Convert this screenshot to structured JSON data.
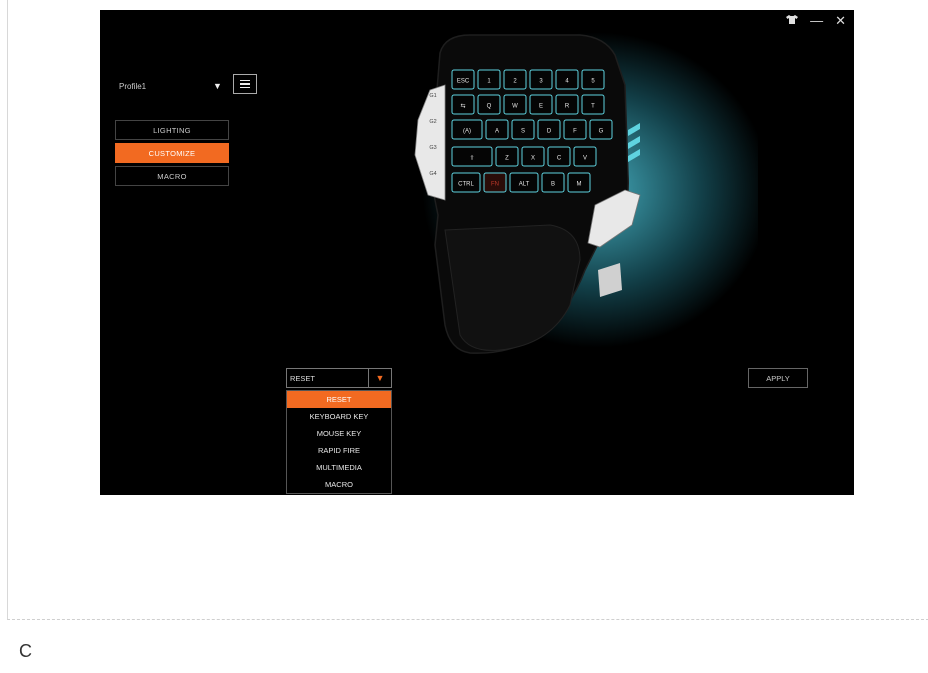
{
  "window_controls": {
    "icon": "shirt-icon",
    "minimize": "—",
    "close": "✕"
  },
  "profile": {
    "name": "Profile1"
  },
  "tabs": [
    {
      "label": "LIGHTING"
    },
    {
      "label": "CUSTOMIZE"
    },
    {
      "label": "MACRO"
    }
  ],
  "keyboard": {
    "side_keys": [
      "G1",
      "G2",
      "G3",
      "G4"
    ],
    "rows": [
      [
        "ESC",
        "1",
        "2",
        "3",
        "4",
        "5"
      ],
      [
        "⇆",
        "Q",
        "W",
        "E",
        "R",
        "T"
      ],
      [
        "(A)",
        "A",
        "S",
        "D",
        "F",
        "G"
      ],
      [
        "⇧",
        "Z",
        "X",
        "C",
        "V"
      ],
      [
        "CTRL",
        "FN",
        "ALT",
        "B",
        "M"
      ]
    ],
    "accent_color": "#5fd3e0",
    "highlight_key": "FN"
  },
  "key_function": {
    "selected": "RESET",
    "options": [
      "RESET",
      "KEYBOARD KEY",
      "MOUSE KEY",
      "RAPID FIRE",
      "MULTIMEDIA",
      "MACRO"
    ]
  },
  "apply_label": "APPLY",
  "caption": "C",
  "colors": {
    "accent": "#f26a21",
    "background": "#000000"
  }
}
